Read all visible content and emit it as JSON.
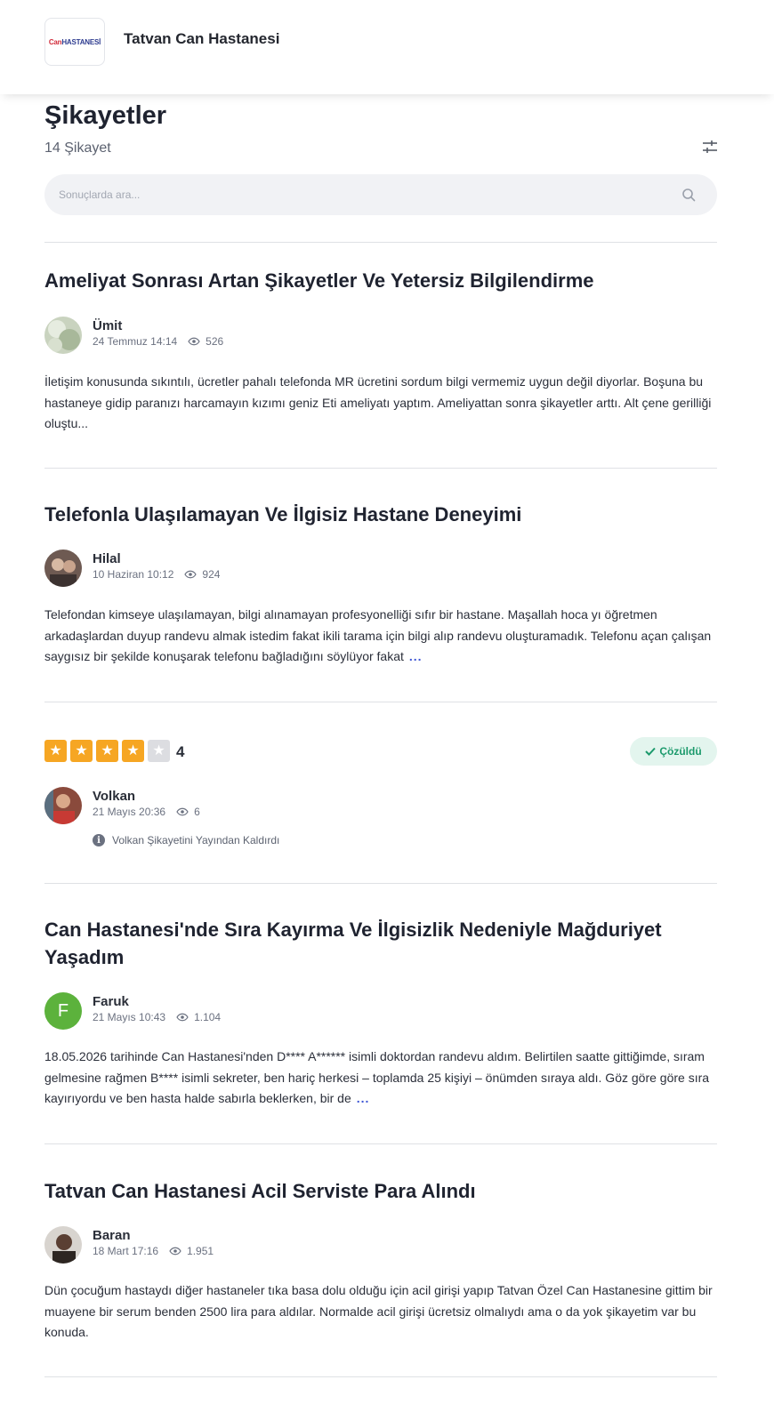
{
  "header": {
    "logo_text": "CanHASTANESİ",
    "logo_prefix": "Can",
    "logo_suffix": "HASTANESİ",
    "brand_name": "Tatvan Can Hastanesi"
  },
  "page": {
    "title": "Şikayetler",
    "count": "14 Şikayet"
  },
  "search": {
    "placeholder": "Sonuçlarda ara..."
  },
  "complaints": [
    {
      "title": "Ameliyat Sonrası Artan Şikayetler Ve Yetersiz Bilgilendirme",
      "author": "Ümit",
      "date": "24 Temmuz 14:14",
      "views": "526",
      "excerpt": "İletişim konusunda sıkıntılı, ücretler pahalı telefonda MR ücretini sordum bilgi vermemiz uygun değil diyorlar. Boşuna bu hastaneye gidip paranızı harcamayın kızımı geniz Eti ameliyatı yaptım. Ameliyattan sonra şikayetler arttı. Alt çene gerilliği oluştu..."
    },
    {
      "title": "Telefonla Ulaşılamayan Ve İlgisiz Hastane Deneyimi",
      "author": "Hilal",
      "date": "10 Haziran 10:12",
      "views": "924",
      "excerpt": "Telefondan kimseye ulaşılamayan, bilgi alınamayan profesyonelliği sıfır bir hastane. Maşallah hoca yı öğretmen arkadaşlardan duyup randevu almak istedim fakat ikili tarama için bilgi alıp randevu oluşturamadık. Telefonu açan çalışan saygısız bir şekilde konuşarak telefonu bağladığını söylüyor fakat",
      "more": "..."
    },
    {
      "rating": "4",
      "status": "Çözüldü",
      "author": "Volkan",
      "date": "21 Mayıs 20:36",
      "views": "6",
      "notice": "Volkan Şikayetini Yayından Kaldırdı"
    },
    {
      "title": "Can Hastanesi'nde Sıra Kayırma Ve İlgisizlik Nedeniyle Mağduriyet Yaşadım",
      "author": "Faruk",
      "avatar_letter": "F",
      "date": "21 Mayıs 10:43",
      "views": "1.104",
      "excerpt": "18.05.2026 tarihinde Can Hastanesi'nden D**** A****** isimli doktordan randevu aldım. Belirtilen saatte gittiğimde, sıram gelmesine rağmen B**** isimli sekreter, ben hariç herkesi – toplamda 25 kişiyi – önümden sıraya aldı. Göz göre göre sıra kayırıyordu ve ben hasta halde sabırla beklerken, bir de",
      "more": "..."
    },
    {
      "title": "Tatvan Can Hastanesi Acil Serviste Para Alındı",
      "author": "Baran",
      "date": "18 Mart 17:16",
      "views": "1.951",
      "excerpt": "Dün çocuğum hastaydı diğer hastaneler tıka basa dolu olduğu için acil girişi yapıp Tatvan Özel Can Hastanesine gittim bir muayene bir serum benden 2500 lira para aldılar. Normalde acil girişi ücretsiz olmalıydı ama o da yok şikayetim var bu konuda."
    }
  ],
  "colors": {
    "accent": "#3d55d4",
    "star": "#f6a623",
    "resolved_bg": "#e3f5ee",
    "resolved_text": "#1c9a6c",
    "avatar_faruk": "#5cb23c"
  },
  "icons": {
    "filter": "sliders-icon",
    "search": "search-icon",
    "views": "eye-icon",
    "resolved": "check-icon",
    "notice": "info-icon"
  }
}
